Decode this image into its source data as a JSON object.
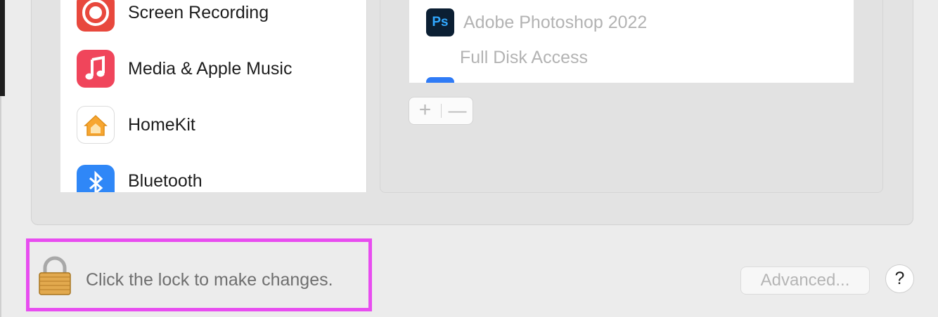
{
  "categories": [
    {
      "label": "Screen Recording",
      "icon": "screen-recording-icon",
      "color": "#e8483d"
    },
    {
      "label": "Media & Apple Music",
      "icon": "music-note-icon",
      "color": "#f0455b"
    },
    {
      "label": "HomeKit",
      "icon": "home-icon",
      "color": "#f7a631"
    },
    {
      "label": "Bluetooth",
      "icon": "bluetooth-icon",
      "color": "#2f87f7"
    }
  ],
  "apps": [
    {
      "icon_text": "Ps",
      "name": "Adobe Photoshop 2022",
      "icon": "photoshop-icon"
    }
  ],
  "section_label": "Full Disk Access",
  "buttons": {
    "add": "+",
    "remove": "—",
    "advanced": "Advanced...",
    "help": "?"
  },
  "lock": {
    "text": "Click the lock to make changes.",
    "icon": "padlock-icon"
  },
  "colors": {
    "highlight": "#e84df0"
  }
}
